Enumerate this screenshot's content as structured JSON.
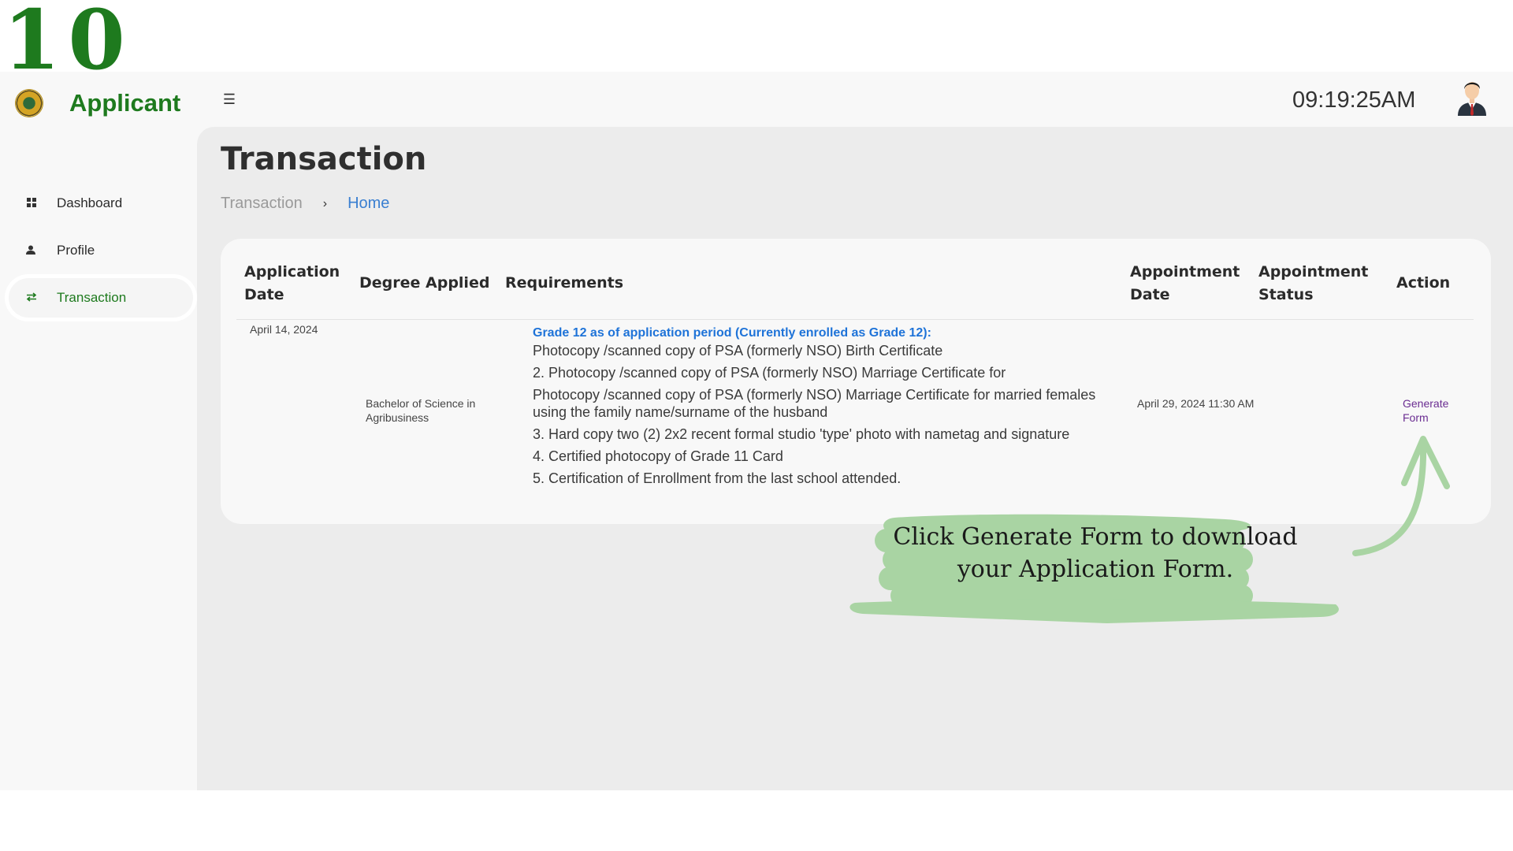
{
  "step_number": "10",
  "app": {
    "title": "Applicant",
    "clock": "09:19:25AM"
  },
  "sidebar": {
    "items": [
      {
        "label": "Dashboard",
        "icon": "dashboard-icon",
        "active": false
      },
      {
        "label": "Profile",
        "icon": "user-icon",
        "active": false
      },
      {
        "label": "Transaction",
        "icon": "swap-icon",
        "active": true
      }
    ]
  },
  "page": {
    "title": "Transaction",
    "breadcrumb": {
      "current": "Transaction",
      "link": "Home"
    }
  },
  "table": {
    "headers": {
      "application_date": "Application Date",
      "degree_applied": "Degree Applied",
      "requirements": "Requirements",
      "appointment_date": "Appointment Date",
      "appointment_status": "Appointment Status",
      "action": "Action"
    },
    "rows": [
      {
        "application_date": "April 14, 2024",
        "degree_applied": "Bachelor of Science in Agribusiness",
        "requirements_heading": "Grade 12 as of application period (Currently enrolled as Grade 12):",
        "requirements": [
          "Photocopy /scanned copy of PSA (formerly NSO) Birth Certificate",
          "2. Photocopy /scanned copy of PSA (formerly NSO) Marriage Certificate for",
          "Photocopy /scanned copy of PSA (formerly NSO) Marriage Certificate for married females using the family name/surname of the husband",
          "3. Hard copy two (2) 2x2 recent formal studio 'type' photo with nametag and signature",
          "4. Certified photocopy of Grade 11 Card",
          "5. Certification of Enrollment from the last school attended."
        ],
        "appointment_date": "April 29, 2024 11:30 AM",
        "appointment_status": "",
        "action": "Generate Form"
      }
    ]
  },
  "callout": {
    "text": "Click Generate Form to download your Application Form."
  },
  "colors": {
    "brand_green": "#1e7a1e",
    "link_blue": "#3a7fd1",
    "requirement_heading_blue": "#1e73d8",
    "action_purple": "#6a2c91",
    "callout_green": "#a9d4a3"
  }
}
